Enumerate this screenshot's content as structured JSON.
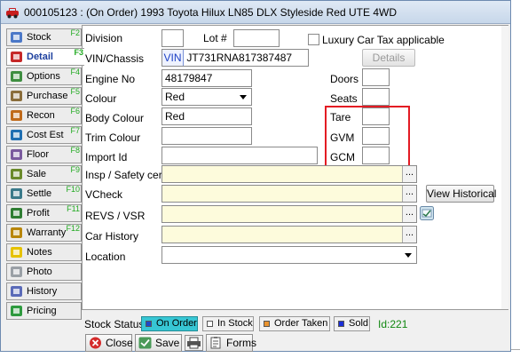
{
  "window": {
    "title": "000105123 : (On Order) 1993 Toyota Hilux LN85 DLX Styleside Red UTE 4WD"
  },
  "tabs": [
    {
      "label": "Stock",
      "fkey": "F2",
      "icon": "stock-icon"
    },
    {
      "label": "Detail",
      "fkey": "F3",
      "icon": "detail-icon",
      "active": true
    },
    {
      "label": "Options",
      "fkey": "F4",
      "icon": "options-icon"
    },
    {
      "label": "Purchase",
      "fkey": "F5",
      "icon": "purchase-icon"
    },
    {
      "label": "Recon",
      "fkey": "F6",
      "icon": "recon-icon"
    },
    {
      "label": "Cost Est",
      "fkey": "F7",
      "icon": "cost-est-icon"
    },
    {
      "label": "Floor",
      "fkey": "F8",
      "icon": "floor-icon"
    },
    {
      "label": "Sale",
      "fkey": "F9",
      "icon": "sale-icon"
    },
    {
      "label": "Settle",
      "fkey": "F10",
      "icon": "settle-icon"
    },
    {
      "label": "Profit",
      "fkey": "F11",
      "icon": "profit-icon"
    },
    {
      "label": "Warranty",
      "fkey": "F12",
      "icon": "warranty-icon"
    },
    {
      "label": "Notes",
      "fkey": "",
      "icon": "notes-icon"
    },
    {
      "label": "Photo",
      "fkey": "",
      "icon": "photo-icon"
    },
    {
      "label": "History",
      "fkey": "",
      "icon": "history-icon"
    },
    {
      "label": "Pricing",
      "fkey": "",
      "icon": "pricing-icon"
    }
  ],
  "form": {
    "division": {
      "label": "Division",
      "value": ""
    },
    "lot": {
      "label": "Lot #",
      "value": ""
    },
    "luxury_tax": {
      "label": "Luxury Car Tax applicable",
      "checked": false
    },
    "vin": {
      "label": "VIN/Chassis",
      "prefix": "VIN",
      "value": "JT731RNA817387487"
    },
    "details_button": "Details",
    "engine": {
      "label": "Engine No",
      "value": "48179847"
    },
    "doors": {
      "label": "Doors",
      "value": ""
    },
    "colour": {
      "label": "Colour",
      "value": "Red"
    },
    "seats": {
      "label": "Seats",
      "value": ""
    },
    "body_colour": {
      "label": "Body Colour",
      "value": "Red"
    },
    "tare": {
      "label": "Tare",
      "value": ""
    },
    "trim_colour": {
      "label": "Trim Colour",
      "value": ""
    },
    "gvm": {
      "label": "GVM",
      "value": ""
    },
    "import_id": {
      "label": "Import Id",
      "value": ""
    },
    "gcm": {
      "label": "GCM",
      "value": ""
    },
    "insp": {
      "label": "Insp / Safety cert",
      "value": ""
    },
    "vcheck": {
      "label": "VCheck",
      "value": ""
    },
    "view_historical": "View Historical",
    "revs": {
      "label": "REVS / VSR",
      "value": ""
    },
    "car_history": {
      "label": "Car History",
      "value": ""
    },
    "location": {
      "label": "Location",
      "value": ""
    },
    "ellipsis": "..."
  },
  "status_bar": {
    "label": "Stock Status",
    "options": [
      {
        "label": "On Order",
        "color": "#1e48c8",
        "active": true
      },
      {
        "label": "In Stock",
        "color": "#ffffff",
        "active": false
      },
      {
        "label": "Order Taken",
        "color": "#e9932f",
        "active": false
      },
      {
        "label": "Sold",
        "color": "#1b2fd8",
        "active": false
      }
    ],
    "id_text": "Id:221"
  },
  "footer": {
    "close": "Close",
    "save": "Save",
    "forms": "Forms"
  },
  "colors": {
    "active_tab_text": "#1c3f9e",
    "highlight_box": "#e31b23",
    "active_status": "#37c6d4",
    "id_text": "#118811",
    "fkey": "#22aa22"
  }
}
